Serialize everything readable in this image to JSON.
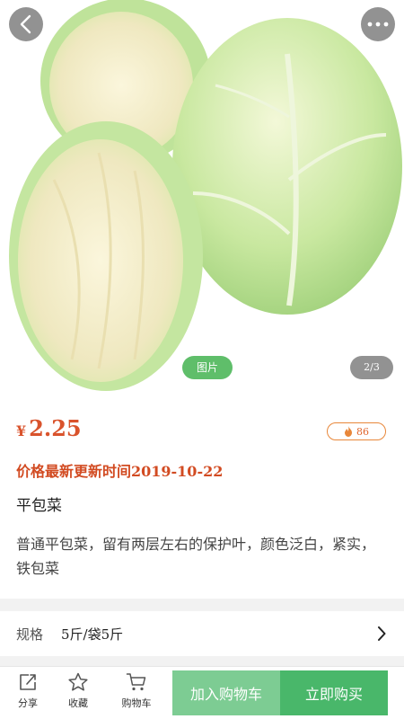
{
  "hero": {
    "photo_label": "图片",
    "image_counter": "2/3",
    "back_icon": "chevron-left-icon",
    "more_icon": "more-dots-icon"
  },
  "product": {
    "price_symbol": "¥",
    "price": "2.25",
    "hot_count": "86",
    "update_text": "价格最新更新时间2019-10-22",
    "name": "平包菜",
    "description": "普通平包菜，留有两层左右的保护叶，颜色泛白，紧实，铁包菜"
  },
  "spec": {
    "label": "规格",
    "value": "5斤/袋5斤"
  },
  "bottom_bar": {
    "share_label": "分享",
    "favorite_label": "收藏",
    "cart_label": "购物车",
    "add_to_cart": "加入购物车",
    "buy_now": "立即购买"
  },
  "colors": {
    "price": "#d9532c",
    "accent_green": "#49b76a",
    "light_green": "#7dcc93",
    "badge_orange": "#e8873a"
  }
}
